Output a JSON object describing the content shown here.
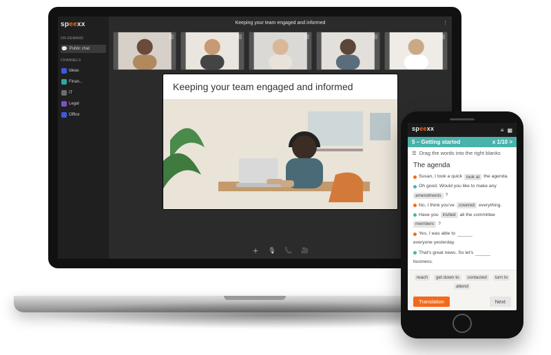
{
  "laptop": {
    "brand": "speexx",
    "meeting_title": "Keeping your team engaged and informed",
    "sidebar": {
      "label_on_demand": "ON DEMAND",
      "on_demand_item": "Public chat",
      "label_channels": "CHANNELS",
      "items": [
        {
          "label": "Ideas"
        },
        {
          "label": "Finan..."
        },
        {
          "label": "IT"
        },
        {
          "label": "Legal"
        },
        {
          "label": "Office"
        }
      ]
    },
    "stage_title": "Keeping your team engaged and informed",
    "controls": {
      "add": "add",
      "mic": "mic",
      "phone": "phone",
      "video": "video"
    }
  },
  "phone": {
    "brand": "speexx",
    "lesson_title": "5 – Getting started",
    "progress": "x 1/10 >",
    "instruction": "Drag the words into the right blanks",
    "heading": "The agenda",
    "sentences": [
      {
        "color": "o",
        "text_parts": [
          "Susan, I took a quick",
          "look at",
          "the agenda."
        ]
      },
      {
        "color": "g",
        "text_parts": [
          "Oh good. Would you like to make any",
          "amendments",
          "?"
        ]
      },
      {
        "color": "o",
        "text_parts": [
          "No, I think you've",
          "covered",
          "everything."
        ]
      },
      {
        "color": "g",
        "text_parts": [
          "Have you",
          "invited",
          "all the committee",
          "members",
          "?"
        ]
      },
      {
        "color": "o",
        "text_parts": [
          "Yes, I was able to",
          "",
          "everyone yesterday."
        ]
      },
      {
        "color": "g",
        "text_parts": [
          "That's great news. So let's",
          "",
          "business."
        ]
      }
    ],
    "word_bank": [
      "reach",
      "get down to",
      "contacted",
      "turn to",
      "attend"
    ],
    "btn_primary": "Translation",
    "btn_secondary": "Next"
  }
}
